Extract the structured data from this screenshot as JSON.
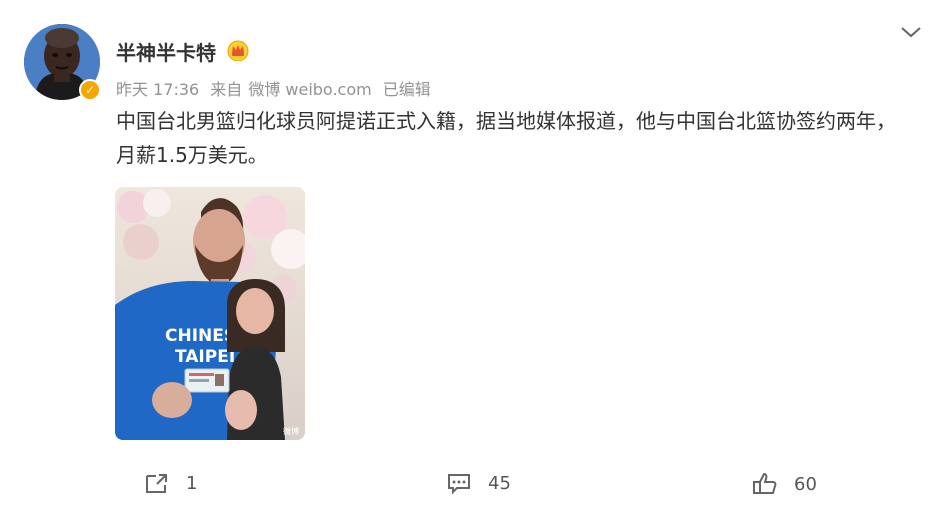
{
  "post": {
    "username": "半神半卡特",
    "meta": {
      "time": "昨天 17:36",
      "source_prefix": "来自",
      "source": "微博 weibo.com",
      "edited": "已编辑"
    },
    "content": "中国台北男篮归化球员阿提诺正式入籍，据当地媒体报道，他与中国台北篮协签约两年，月薪1.5万美元。",
    "photo": {
      "shirt_text_line1": "CHINESE",
      "shirt_text_line2": "TAIPEI",
      "watermark": "微博"
    }
  },
  "icons": {
    "collapse": "chevron-down-icon",
    "verified": "verified-badge-icon",
    "crown": "crown-icon",
    "share": "share-icon",
    "comment": "comment-icon",
    "like": "thumbs-up-icon"
  },
  "actions": {
    "share_count": "1",
    "comment_count": "45",
    "like_count": "60"
  },
  "colors": {
    "meta": "#939393",
    "badge": "#f7a600",
    "text": "#333333"
  }
}
